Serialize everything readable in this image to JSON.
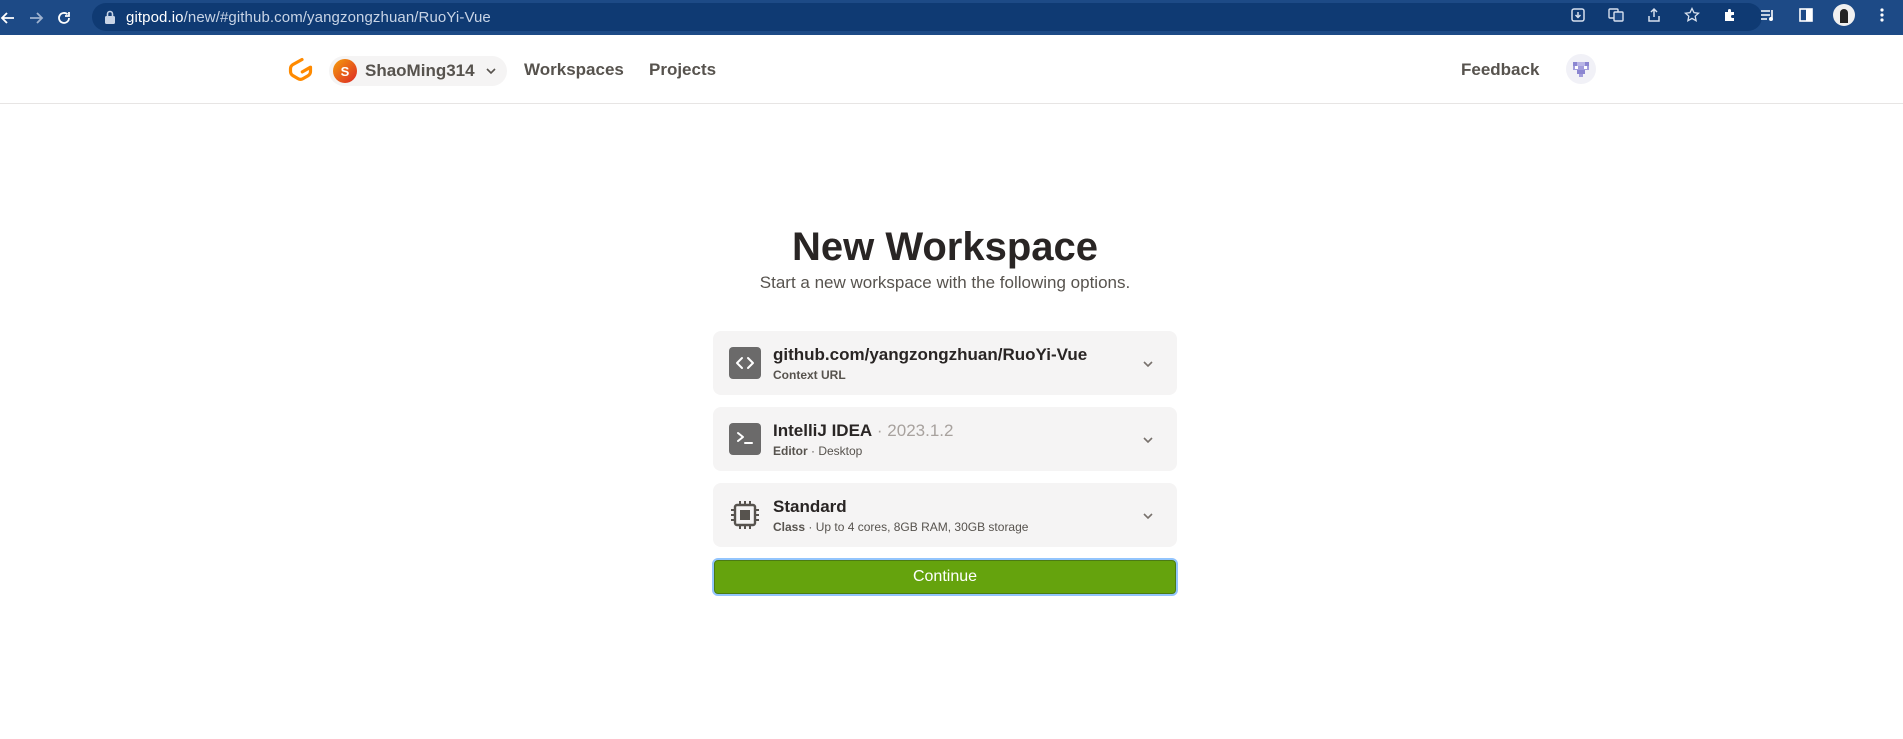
{
  "browser": {
    "url_host": "gitpod.io",
    "url_path": "/new/#github.com/yangzongzhuan/RuoYi-Vue",
    "icons": [
      "back-icon",
      "forward-icon",
      "reload-icon",
      "lock-icon",
      "install-icon",
      "translate-icon",
      "share-icon",
      "bookmark-star-icon",
      "extensions-icon",
      "reading-list-icon",
      "side-panel-icon",
      "profile-avatar",
      "more-menu-icon"
    ]
  },
  "header": {
    "org_initial": "S",
    "org_name": "ShaoMing314",
    "nav": {
      "workspaces": "Workspaces",
      "projects": "Projects"
    },
    "feedback": "Feedback",
    "brand_color": "#ff8a00"
  },
  "main": {
    "title": "New Workspace",
    "subtitle": "Start a new workspace with the following options.",
    "options": [
      {
        "main": "github.com/yangzongzhuan/RuoYi-Vue",
        "main_muted": "",
        "sub_label": "Context URL",
        "sub_detail": "",
        "icon": "code-icon"
      },
      {
        "main": "IntelliJ IDEA",
        "main_muted": " · 2023.1.2",
        "sub_label": "Editor",
        "sub_detail": " · Desktop",
        "icon": "terminal-icon"
      },
      {
        "main": "Standard",
        "main_muted": "",
        "sub_label": "Class",
        "sub_detail": " · Up to 4 cores, 8GB RAM, 30GB storage",
        "icon": "cpu-icon"
      }
    ],
    "continue_label": "Continue",
    "continue_color": "#65a30d"
  }
}
